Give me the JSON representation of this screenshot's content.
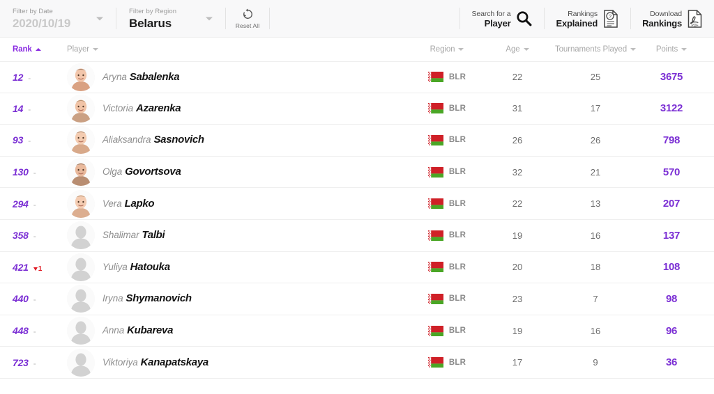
{
  "filters": {
    "date": {
      "label": "Filter by Date",
      "value": "2020/10/19",
      "icon": "chevron-down-icon"
    },
    "region": {
      "label": "Filter by Region",
      "value": "Belarus",
      "icon": "chevron-down-icon"
    },
    "reset": {
      "label": "Reset All",
      "icon": "refresh-icon"
    }
  },
  "actions": [
    {
      "line1": "Search for a",
      "line2": "Player",
      "icon": "search-icon",
      "name": "search-player-button"
    },
    {
      "line1": "Rankings",
      "line2": "Explained",
      "icon": "help-document-icon",
      "name": "rankings-explained-button"
    },
    {
      "line1": "Download",
      "line2": "Rankings",
      "icon": "pdf-document-icon",
      "name": "download-rankings-button"
    }
  ],
  "columns": [
    {
      "key": "rank",
      "label": "Rank",
      "sorted": true,
      "direction": "asc"
    },
    {
      "key": "player",
      "label": "Player",
      "sorted": false,
      "direction": "desc"
    },
    {
      "key": "region",
      "label": "Region",
      "sorted": false,
      "direction": "desc"
    },
    {
      "key": "age",
      "label": "Age",
      "sorted": false,
      "direction": "desc"
    },
    {
      "key": "tournaments",
      "label": "Tournaments Played",
      "sorted": false,
      "direction": "desc"
    },
    {
      "key": "points",
      "label": "Points",
      "sorted": false,
      "direction": "desc"
    }
  ],
  "rows": [
    {
      "rank": "12",
      "move": "-",
      "move_dir": "flat",
      "first": "Aryna",
      "last": "Sabalenka",
      "photo": true,
      "region_code": "BLR",
      "region_flag": "belarus-flag-icon",
      "age": "22",
      "tournaments": "25",
      "points": "3675"
    },
    {
      "rank": "14",
      "move": "-",
      "move_dir": "flat",
      "first": "Victoria",
      "last": "Azarenka",
      "photo": true,
      "region_code": "BLR",
      "region_flag": "belarus-flag-icon",
      "age": "31",
      "tournaments": "17",
      "points": "3122"
    },
    {
      "rank": "93",
      "move": "-",
      "move_dir": "flat",
      "first": "Aliaksandra",
      "last": "Sasnovich",
      "photo": true,
      "region_code": "BLR",
      "region_flag": "belarus-flag-icon",
      "age": "26",
      "tournaments": "26",
      "points": "798"
    },
    {
      "rank": "130",
      "move": "-",
      "move_dir": "flat",
      "first": "Olga",
      "last": "Govortsova",
      "photo": true,
      "region_code": "BLR",
      "region_flag": "belarus-flag-icon",
      "age": "32",
      "tournaments": "21",
      "points": "570"
    },
    {
      "rank": "294",
      "move": "-",
      "move_dir": "flat",
      "first": "Vera",
      "last": "Lapko",
      "photo": true,
      "region_code": "BLR",
      "region_flag": "belarus-flag-icon",
      "age": "22",
      "tournaments": "13",
      "points": "207"
    },
    {
      "rank": "358",
      "move": "-",
      "move_dir": "flat",
      "first": "Shalimar",
      "last": "Talbi",
      "photo": false,
      "region_code": "BLR",
      "region_flag": "belarus-flag-icon",
      "age": "19",
      "tournaments": "16",
      "points": "137"
    },
    {
      "rank": "421",
      "move": "1",
      "move_dir": "down",
      "first": "Yuliya",
      "last": "Hatouka",
      "photo": false,
      "region_code": "BLR",
      "region_flag": "belarus-flag-icon",
      "age": "20",
      "tournaments": "18",
      "points": "108"
    },
    {
      "rank": "440",
      "move": "-",
      "move_dir": "flat",
      "first": "Iryna",
      "last": "Shymanovich",
      "photo": false,
      "region_code": "BLR",
      "region_flag": "belarus-flag-icon",
      "age": "23",
      "tournaments": "7",
      "points": "98"
    },
    {
      "rank": "448",
      "move": "-",
      "move_dir": "flat",
      "first": "Anna",
      "last": "Kubareva",
      "photo": false,
      "region_code": "BLR",
      "region_flag": "belarus-flag-icon",
      "age": "19",
      "tournaments": "16",
      "points": "96"
    },
    {
      "rank": "723",
      "move": "-",
      "move_dir": "flat",
      "first": "Viktoriya",
      "last": "Kanapatskaya",
      "photo": false,
      "region_code": "BLR",
      "region_flag": "belarus-flag-icon",
      "age": "17",
      "tournaments": "9",
      "points": "36"
    }
  ],
  "colors": {
    "accent": "#7b2fd4",
    "accent_header": "#8a2be2",
    "down": "#e01b24",
    "flag_red": "#cf2027",
    "flag_green": "#4aa625"
  }
}
